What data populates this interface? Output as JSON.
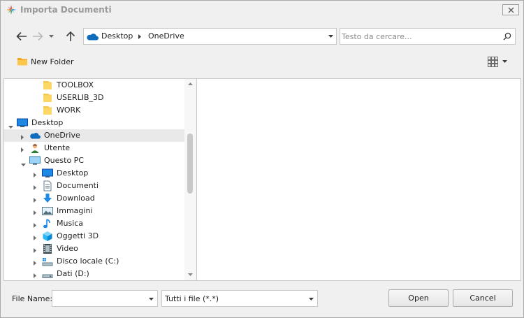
{
  "window": {
    "title": "Importa Documenti"
  },
  "address_bar": {
    "crumbs": [
      "Desktop",
      "OneDrive"
    ]
  },
  "search": {
    "placeholder": "Testo da cercare..."
  },
  "toolbar": {
    "new_folder_label": "New Folder"
  },
  "tree": {
    "items": [
      {
        "label": "TOOLBOX",
        "icon": "folder-icon",
        "level": 2,
        "expander": "none",
        "highlighted": false
      },
      {
        "label": "USERLIB_3D",
        "icon": "folder-icon",
        "level": 2,
        "expander": "none",
        "highlighted": false
      },
      {
        "label": "WORK",
        "icon": "folder-icon",
        "level": 2,
        "expander": "none",
        "highlighted": false
      },
      {
        "label": "Desktop",
        "icon": "desktop-icon",
        "level": 0,
        "expander": "expanded",
        "highlighted": false
      },
      {
        "label": "OneDrive",
        "icon": "onedrive-icon",
        "level": 1,
        "expander": "collapsed",
        "highlighted": true
      },
      {
        "label": "Utente",
        "icon": "user-icon",
        "level": 1,
        "expander": "collapsed",
        "highlighted": false
      },
      {
        "label": "Questo PC",
        "icon": "computer-icon",
        "level": 1,
        "expander": "expanded",
        "highlighted": false
      },
      {
        "label": "Desktop",
        "icon": "desktop-icon",
        "level": 2,
        "expander": "collapsed",
        "highlighted": false
      },
      {
        "label": "Documenti",
        "icon": "documents-icon",
        "level": 2,
        "expander": "collapsed",
        "highlighted": false
      },
      {
        "label": "Download",
        "icon": "download-icon",
        "level": 2,
        "expander": "collapsed",
        "highlighted": false
      },
      {
        "label": "Immagini",
        "icon": "pictures-icon",
        "level": 2,
        "expander": "collapsed",
        "highlighted": false
      },
      {
        "label": "Musica",
        "icon": "music-icon",
        "level": 2,
        "expander": "collapsed",
        "highlighted": false
      },
      {
        "label": "Oggetti 3D",
        "icon": "3d-objects-icon",
        "level": 2,
        "expander": "collapsed",
        "highlighted": false
      },
      {
        "label": "Video",
        "icon": "video-icon",
        "level": 2,
        "expander": "collapsed",
        "highlighted": false
      },
      {
        "label": "Disco locale (C:)",
        "icon": "local-disk-icon",
        "level": 2,
        "expander": "collapsed",
        "highlighted": false
      },
      {
        "label": "Dati (D:)",
        "icon": "drive-icon",
        "level": 2,
        "expander": "collapsed",
        "highlighted": false
      }
    ]
  },
  "footer": {
    "file_name_label": "File Name:",
    "file_name_value": "",
    "file_type_value": "Tutti i file (*.*)",
    "open_label": "Open",
    "cancel_label": "Cancel"
  },
  "colors": {
    "highlight_row": "#e9e9e9",
    "onedrive_blue": "#0f6cbd",
    "folder_yellow": "#fcd766"
  }
}
